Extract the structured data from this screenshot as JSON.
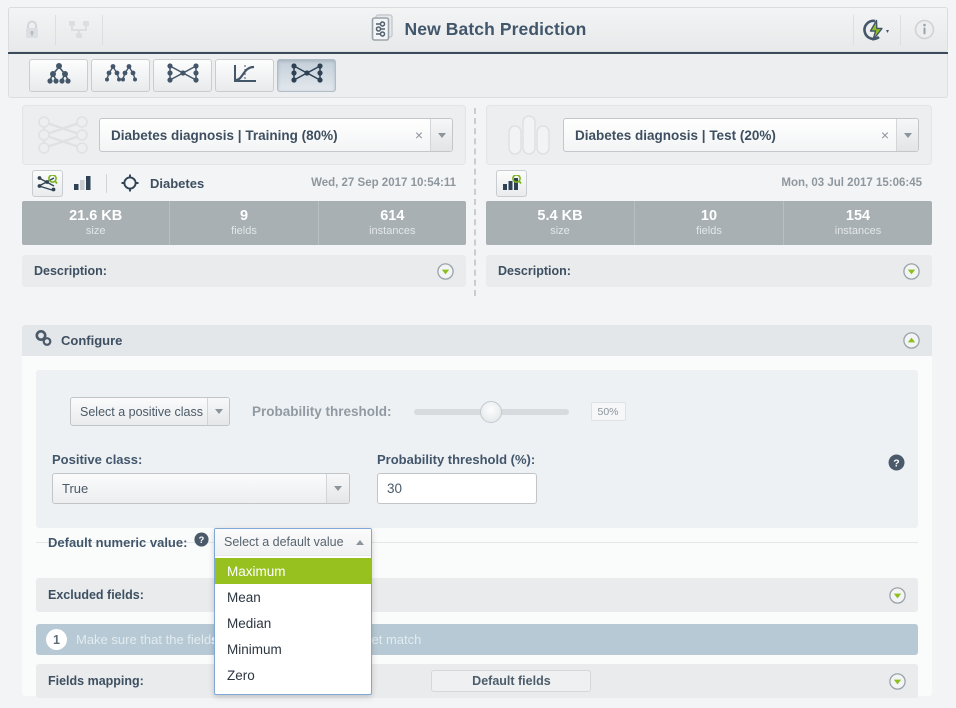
{
  "header": {
    "title": "New Batch Prediction",
    "title_icon": "batch-prediction-icon",
    "lock_icon": "lock-icon",
    "share_icon": "share-network-icon",
    "actions_icon": "lightning-bolt-icon",
    "info_icon": "info-circle-icon"
  },
  "toolbar": {
    "tabs": [
      {
        "name": "tab-model",
        "icon": "decision-tree-icon",
        "active": false
      },
      {
        "name": "tab-ensemble",
        "icon": "ensemble-trees-icon",
        "active": false
      },
      {
        "name": "tab-deepnet",
        "icon": "neural-network-icon",
        "active": false
      },
      {
        "name": "tab-logistic",
        "icon": "logistic-curve-icon",
        "active": false
      },
      {
        "name": "tab-batch-pred",
        "icon": "neural-network-icon",
        "active": true
      }
    ]
  },
  "panels": {
    "left": {
      "thumb_icon": "network-graph-icon",
      "source_value": "Diabetes diagnosis | Training (80%)",
      "clear_label": "×",
      "meta": {
        "primary_icon": "model-search-icon",
        "secondary_icon": "bar-chart-icon",
        "objective_icon": "target-icon",
        "name": "Diabetes",
        "date": "Wed, 27 Sep 2017 10:54:11"
      },
      "stats": [
        {
          "value": "21.6 KB",
          "key": "size"
        },
        {
          "value": "9",
          "key": "fields"
        },
        {
          "value": "614",
          "key": "instances"
        }
      ],
      "description_label": "Description:"
    },
    "right": {
      "thumb_icon": "dataset-bars-icon",
      "source_value": "Diabetes diagnosis | Test (20%)",
      "clear_label": "×",
      "meta": {
        "primary_icon": "dataset-search-icon",
        "date": "Mon, 03 Jul 2017 15:06:45"
      },
      "stats": [
        {
          "value": "5.4 KB",
          "key": "size"
        },
        {
          "value": "10",
          "key": "fields"
        },
        {
          "value": "154",
          "key": "instances"
        }
      ],
      "description_label": "Description:"
    }
  },
  "configure": {
    "title": "Configure",
    "gear_icon": "gears-icon",
    "collapse_icon": "chevron-up-circle-icon",
    "positive_class_selector_placeholder": "Select a positive class",
    "probability_threshold_label": "Probability threshold:",
    "slider_value": "50%",
    "positive_class_label": "Positive class:",
    "positive_class_value": "True",
    "probability_threshold_pct_label": "Probability threshold (%):",
    "probability_threshold_pct_value": "30",
    "help_icon": "question-circle-icon",
    "default_numeric_label": "Default numeric value:",
    "default_numeric_help_icon": "question-circle-icon",
    "dropdown": {
      "placeholder": "Select a default value",
      "caret_icon": "caret-up-icon",
      "options": [
        "Maximum",
        "Mean",
        "Median",
        "Minimum",
        "Zero"
      ],
      "highlighted": "Maximum"
    },
    "excluded_fields_label": "Excluded fields:",
    "notice": {
      "number": "1",
      "text_start": "Make sure that the field",
      "text_bold": "s of your model and data",
      "text_mid": "set",
      "text_end": " match"
    },
    "fields_mapping_label": "Fields mapping:",
    "default_fields_button": "Default fields",
    "expand_icon": "chevron-down-circle-icon"
  },
  "colors": {
    "accent_green": "#97c11f",
    "stats_grey": "#a8b0b3",
    "notice_blue": "#b6c9d4",
    "text_dark": "#3d4f60"
  }
}
